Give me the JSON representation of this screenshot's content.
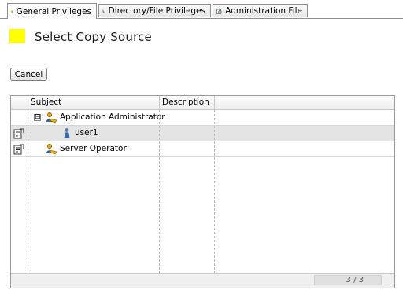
{
  "tabs": [
    {
      "label": "General Privileges",
      "icon": "lock-icon",
      "active": true
    },
    {
      "label": "Directory/File Privileges",
      "icon": "directory-tree-icon",
      "active": false
    },
    {
      "label": "Administration File",
      "icon": "admin-file-icon",
      "active": false
    }
  ],
  "header": {
    "title": "Select Copy Source",
    "marker_color": "#ffff00"
  },
  "actions": {
    "cancel_label": "Cancel"
  },
  "table": {
    "columns": [
      "Subject",
      "Description"
    ],
    "rows": [
      {
        "subject": "Application Administrator",
        "description": "",
        "icon": "user-group-icon",
        "expander": "⊟",
        "selected": false
      },
      {
        "subject": "user1",
        "description": "",
        "icon": "user-icon",
        "selected": true
      },
      {
        "subject": "Server Operator",
        "description": "",
        "icon": "user-group-icon",
        "selected": false
      }
    ],
    "pager": "3 / 3"
  }
}
